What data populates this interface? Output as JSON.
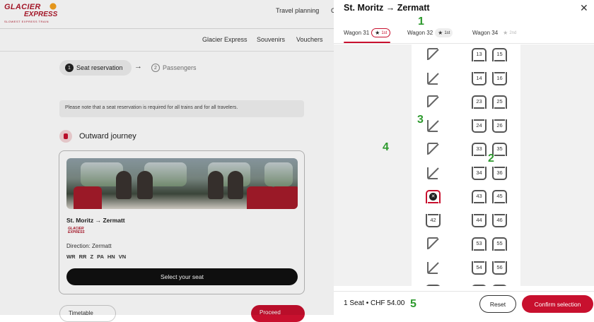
{
  "background": {
    "logo": {
      "line1": "GLACIER",
      "line2": "EXPRESS",
      "tagline": "SLOWEST EXPRESS TRAIN"
    },
    "topnav": {
      "travel_planning": "Travel planning",
      "cut_off": "C"
    },
    "subnav": [
      "Glacier Express",
      "Souvenirs",
      "Vouchers"
    ],
    "stepper": [
      {
        "num": "1",
        "label": "Seat reservation"
      },
      {
        "num": "2",
        "label": "Passengers"
      }
    ],
    "notice": "Please note that a seat reservation is required for all trains and for all travelers.",
    "outward_journey": "Outward journey",
    "card": {
      "route": "St. Moritz → Zermatt",
      "logo_text": "GLACIER EXPRESS",
      "direction": "Direction: Zermatt",
      "codes": "WR RR Z PA HN VN",
      "select_button": "Select your seat"
    },
    "bottom_left": "Timetable",
    "bottom_right": "Proceed"
  },
  "drawer": {
    "title": "St. Moritz → Zermatt",
    "tabs": [
      {
        "label": "Wagon 31",
        "class": "1st",
        "state": "selected"
      },
      {
        "label": "Wagon 32",
        "class": "1st",
        "state": "normal"
      },
      {
        "label": "Wagon 34",
        "class": "2nd",
        "state": "disabled"
      }
    ],
    "seat_rows": [
      {
        "left": "wheelchair",
        "a": "13",
        "b": "15",
        "facing": "up"
      },
      {
        "left": "wheelchair",
        "a": "14",
        "b": "16",
        "facing": "down"
      },
      {
        "left": "wheelchair",
        "a": "23",
        "b": "25",
        "facing": "up"
      },
      {
        "left": "wheelchair",
        "a": "24",
        "b": "26",
        "facing": "down"
      },
      {
        "left": "wheelchair",
        "a": "33",
        "b": "35",
        "facing": "up"
      },
      {
        "left": "wheelchair",
        "a": "34",
        "b": "36",
        "facing": "down"
      },
      {
        "left": "selected",
        "a": "43",
        "b": "45",
        "facing": "up"
      },
      {
        "left": "42",
        "a": "44",
        "b": "46",
        "facing": "down"
      },
      {
        "left": "wheelchair",
        "a": "53",
        "b": "55",
        "facing": "up"
      },
      {
        "left": "wheelchair",
        "a": "54",
        "b": "56",
        "facing": "down"
      }
    ],
    "summary": "1 Seat • CHF 54.00",
    "reset": "Reset",
    "confirm": "Confirm selection"
  },
  "annotations": [
    "1",
    "2",
    "3",
    "4",
    "5"
  ],
  "colors": {
    "brand_red": "#c8102e",
    "annotation_green": "#2e9a2e"
  }
}
